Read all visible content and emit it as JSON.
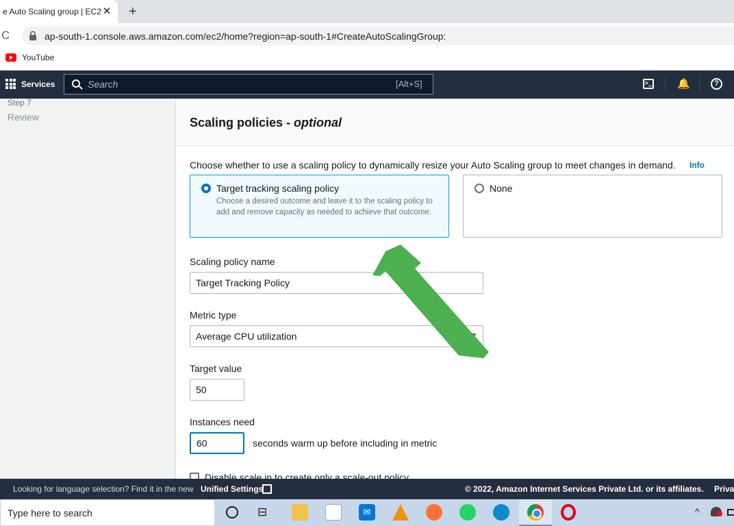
{
  "browser": {
    "tab_title": "e Auto Scaling group | EC2",
    "tab_close_glyph": "✕",
    "new_tab_glyph": "+",
    "reload_glyph": "C",
    "url": "ap-south-1.console.aws.amazon.com/ec2/home?region=ap-south-1#CreateAutoScalingGroup:",
    "bookmarks": [
      {
        "label": "YouTube",
        "icon": "youtube-icon"
      }
    ]
  },
  "aws_nav": {
    "services_label": "Services",
    "search_placeholder": "Search",
    "search_shortcut": "[Alt+S]",
    "cloudshell_glyph": ">_",
    "bell_glyph": "🔔",
    "help_glyph": "?"
  },
  "sidebar": {
    "step_label": "Step 7",
    "step_name": "Review"
  },
  "main": {
    "heading": "Scaling policies - ",
    "heading_optional": "optional",
    "description": "Choose whether to use a scaling policy to dynamically resize your Auto Scaling group to meet changes in demand.",
    "info_link": "Info",
    "options": [
      {
        "title": "Target tracking scaling policy",
        "description": "Choose a desired outcome and leave it to the scaling policy to add and remove capacity as needed to achieve that outcome.",
        "selected": true
      },
      {
        "title": "None",
        "selected": false
      }
    ],
    "policy_name_label": "Scaling policy name",
    "policy_name_value": "Target Tracking Policy",
    "metric_type_label": "Metric type",
    "metric_type_value": "Average CPU utilization",
    "target_value_label": "Target value",
    "target_value": "50",
    "instances_need_label": "Instances need",
    "instances_need_value": "60",
    "instances_need_suffix": "seconds warm up before including in metric",
    "disable_scale_in_label": "Disable scale in to create only a scale-out policy"
  },
  "annotation": {
    "arrow_color": "#4caf50"
  },
  "footer": {
    "language_text": "Looking for language selection? Find it in the new",
    "unified_settings_link": "Unified Settings",
    "copyright": "© 2022, Amazon Internet Services Private Ltd. or its affiliates.",
    "privacy_link": "Priva"
  },
  "taskbar": {
    "search_placeholder": "Type here to search",
    "tray_up_glyph": "^",
    "apps": [
      "cortana-icon",
      "task-view-icon",
      "file-explorer-icon",
      "store-icon",
      "mail-icon",
      "vlc-icon",
      "firefox-icon",
      "whatsapp-icon",
      "edge-icon",
      "chrome-icon",
      "opera-icon"
    ]
  },
  "colors": {
    "aws_nav_bg": "#232f3e",
    "primary_blue": "#0073bb",
    "selected_tile_bg": "#f1faff"
  }
}
